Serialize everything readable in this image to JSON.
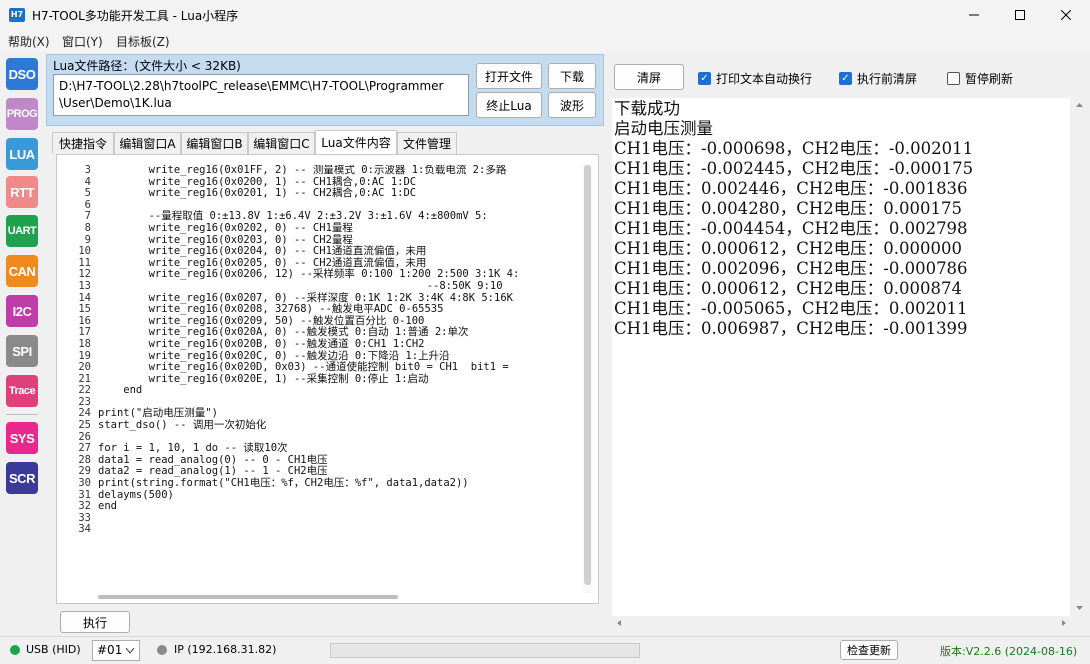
{
  "window": {
    "icon_label": "H7",
    "title": "H7-TOOL多功能开发工具 - Lua小程序"
  },
  "menu": [
    "帮助(X)",
    "窗口(Y)",
    "目标板(Z)"
  ],
  "sidebar": [
    {
      "label": "DSO",
      "color": "#2f78d4"
    },
    {
      "label": "PROG",
      "color": "#c088c8"
    },
    {
      "label": "LUA",
      "color": "#3a9ad8"
    },
    {
      "label": "RTT",
      "color": "#f08a8a"
    },
    {
      "label": "UART",
      "color": "#1fa24e"
    },
    {
      "label": "CAN",
      "color": "#f08a1e"
    },
    {
      "label": "I2C",
      "color": "#c03ca8"
    },
    {
      "label": "SPI",
      "color": "#8a8a8a"
    },
    {
      "label": "Trace",
      "color": "#e0407a"
    },
    {
      "label": "SYS",
      "color": "#e8288c"
    },
    {
      "label": "SCR",
      "color": "#3a3a9a"
    }
  ],
  "lua_panel": {
    "path_label": "Lua文件路径：(文件大小 < 32KB)",
    "path_value": "D:\\H7-TOOL\\2.28\\h7toolPC_release\\EMMC\\H7-TOOL\\Programmer\n\\User\\Demo\\1K.lua",
    "open_label": "打开文件",
    "download_label": "下载",
    "stop_label": "终止Lua",
    "wave_label": "波形",
    "tabs": [
      "快捷指令",
      "编辑窗口A",
      "编辑窗口B",
      "编辑窗口C",
      "Lua文件内容",
      "文件管理"
    ],
    "active_tab": 4,
    "line_numbers": "3\n4\n5\n6\n7\n8\n9\n10\n11\n12\n13\n14\n15\n16\n17\n18\n19\n20\n21\n22\n23\n24\n25\n26\n27\n28\n29\n30\n31\n32\n33\n34",
    "code": "        write_reg16(0x01FF, 2) -- 测量模式 0:示波器 1:负载电流 2:多路\n        write_reg16(0x0200, 1) -- CH1耦合,0:AC 1:DC\n        write_reg16(0x0201, 1) -- CH2耦合,0:AC 1:DC\n\n        --量程取值 0:±13.8V 1:±6.4V 2:±3.2V 3:±1.6V 4:±800mV 5:\n        write_reg16(0x0202, 0) -- CH1量程\n        write_reg16(0x0203, 0) -- CH2量程\n        write_reg16(0x0204, 0) -- CH1通道直流偏值，未用\n        write_reg16(0x0205, 0) -- CH2通道直流偏值，未用\n        write_reg16(0x0206, 12) --采样频率 0:100 1:200 2:500 3:1K 4:\n                                                    --8:50K 9:10\n        write_reg16(0x0207, 0) --采样深度 0:1K 1:2K 3:4K 4:8K 5:16K\n        write_reg16(0x0208, 32768) --触发电平ADC 0-65535\n        write_reg16(0x0209, 50) --触发位置百分比 0-100\n        write_reg16(0x020A, 0) --触发模式 0:自动 1:普通 2:单次\n        write_reg16(0x020B, 0) --触发通道 0:CH1 1:CH2\n        write_reg16(0x020C, 0) --触发边沿 0:下降沿 1:上升沿\n        write_reg16(0x020D, 0x03) --通道使能控制 bit0 = CH1  bit1 =\n        write_reg16(0x020E, 1) --采集控制 0:停止 1:启动\n    end\n\nprint(\"启动电压测量\")\nstart_dso() -- 调用一次初始化\n\nfor i = 1, 10, 1 do -- 读取10次\ndata1 = read_analog(0) -- 0 - CH1电压\ndata2 = read_analog(1) -- 1 - CH2电压\nprint(string.format(\"CH1电压：%f，CH2电压：%f\", data1,data2))\ndelayms(500)\nend\n\n",
    "exec_label": "执行"
  },
  "output_panel": {
    "clear_label": "清屏",
    "wrap_label": "打印文本自动换行",
    "wrap_checked": true,
    "clear_before_label": "执行前清屏",
    "clear_before_checked": true,
    "pause_label": "暂停刷新",
    "pause_checked": false,
    "text": "下载成功\n启动电压测量\nCH1电压：-0.000698，CH2电压：-0.002011\nCH1电压：-0.002445，CH2电压：-0.000175\nCH1电压：0.002446，CH2电压：-0.001836\nCH1电压：0.004280，CH2电压：0.000175\nCH1电压：-0.004454，CH2电压：0.002798\nCH1电压：0.000612，CH2电压：0.000000\nCH1电压：0.002096，CH2电压：-0.000786\nCH1电压：0.000612，CH2电压：0.000874\nCH1电压：-0.005065，CH2电压：0.002011\nCH1电压：0.006987，CH2电压：-0.001399"
  },
  "status": {
    "usb": "USB (HID)",
    "usb_color": "#1fa24e",
    "device": "#01",
    "ip": "IP (192.168.31.82)",
    "ip_color": "#8a8a8a",
    "update_label": "检查更新",
    "version": "版本:V2.2.6 (2024-08-16)",
    "version_color": "#1a7a1a"
  }
}
